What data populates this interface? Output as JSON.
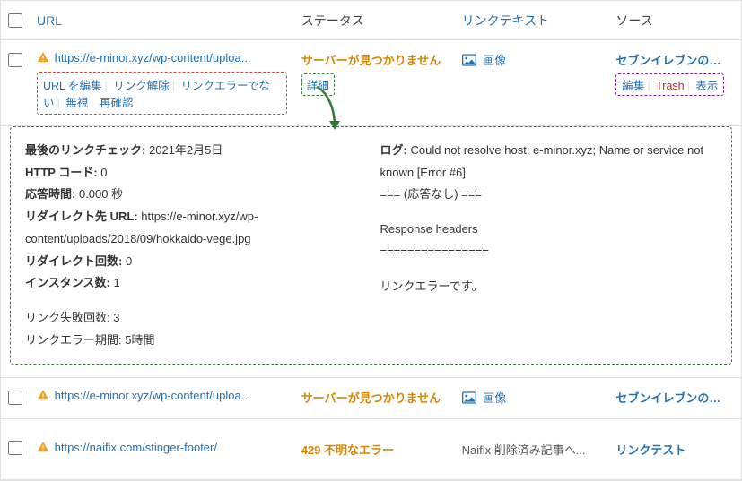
{
  "headers": {
    "url": "URL",
    "status": "ステータス",
    "linktext": "リンクテキスト",
    "source": "ソース"
  },
  "row1": {
    "url": "https://e-minor.xyz/wp-content/uploa...",
    "status": "サーバーが見つかりません",
    "linktext": "画像",
    "source": "セブンイレブンのカ...",
    "actions": {
      "edit_url": "URL を編集",
      "unlink": "リンク解除",
      "not_error": "リンクエラーでない",
      "dismiss": "無視",
      "recheck": "再確認",
      "details": "詳細"
    },
    "src_actions": {
      "edit": "編集",
      "trash": "Trash",
      "view": "表示"
    }
  },
  "detail": {
    "left": {
      "last_check_label": "最後のリンクチェック:",
      "last_check": "2021年2月5日",
      "http_label": "HTTP コード:",
      "http": "0",
      "resp_time_label": "応答時間:",
      "resp_time": "0.000 秒",
      "redirect_label": "リダイレクト先 URL:",
      "redirect": "https://e-minor.xyz/wp-content/uploads/2018/09/hokkaido-vege.jpg",
      "redirect_cnt_label": "リダイレクト回数:",
      "redirect_cnt": "0",
      "instances_label": "インスタンス数:",
      "instances": "1",
      "fail_cnt_label": "リンク失敗回数:",
      "fail_cnt": "3",
      "err_period_label": "リンクエラー期間:",
      "err_period": "5時間"
    },
    "right": {
      "log_label": "ログ:",
      "log1": "Could not resolve host: e-minor.xyz; Name or service not known [Error #6]",
      "log2": "=== (応答なし) ===",
      "resp_hdr": "Response headers",
      "sep": "================",
      "final": "リンクエラーです。"
    }
  },
  "row2": {
    "url": "https://e-minor.xyz/wp-content/uploa...",
    "status": "サーバーが見つかりません",
    "linktext": "画像",
    "source": "セブンイレブンのカ..."
  },
  "row3": {
    "url": "https://naifix.com/stinger-footer/",
    "status": "429 不明なエラー",
    "linktext": "Naifix 削除済み記事へ...",
    "source": "リンクテスト"
  }
}
